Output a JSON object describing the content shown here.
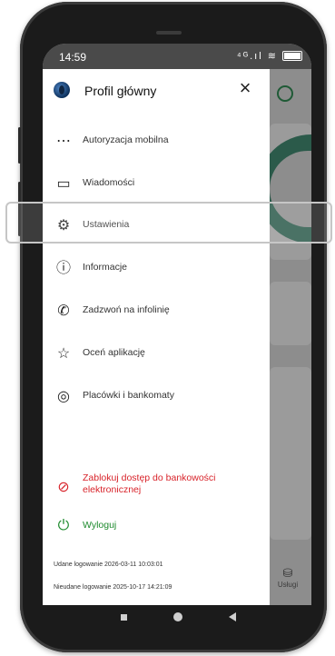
{
  "status_bar": {
    "time": "14:59",
    "icons": "⁴ᴳ.ıl ≋"
  },
  "drawer": {
    "title": "Profil główny",
    "close_icon": "×",
    "items": [
      {
        "label": "Autoryzacja mobilna",
        "icon": "mobile-authorization-icon",
        "glyph": "⋯"
      },
      {
        "label": "Wiadomości",
        "icon": "message-icon",
        "glyph": "▭"
      },
      {
        "label": "Ustawienia",
        "icon": "gear-icon",
        "glyph": "⚙"
      },
      {
        "label": "Informacje",
        "icon": "info-icon",
        "glyph": "ⓘ"
      },
      {
        "label": "Zadzwoń na infolinię",
        "icon": "phone-icon",
        "glyph": "✆"
      },
      {
        "label": "Oceń aplikację",
        "icon": "star-icon",
        "glyph": "☆"
      },
      {
        "label": "Placówki i bankomaty",
        "icon": "location-icon",
        "glyph": "◎"
      }
    ],
    "block_access": {
      "label_line1": "Zablokuj dostęp do bankowości",
      "label_line2": "elektronicznej",
      "glyph": "⊘"
    },
    "logout": {
      "label": "Wyloguj",
      "glyph": "⏻"
    },
    "last_login_success": "Udane logowanie 2026-03-11 10:03:01",
    "last_login_failed": "Nieudane logowanie 2025-10-17 14:21:09"
  },
  "background": {
    "services_label": "Usługi"
  },
  "colors": {
    "accent_red": "#d8232a",
    "accent_green": "#1e8b2e",
    "highlight_border": "#c6c6c6"
  }
}
